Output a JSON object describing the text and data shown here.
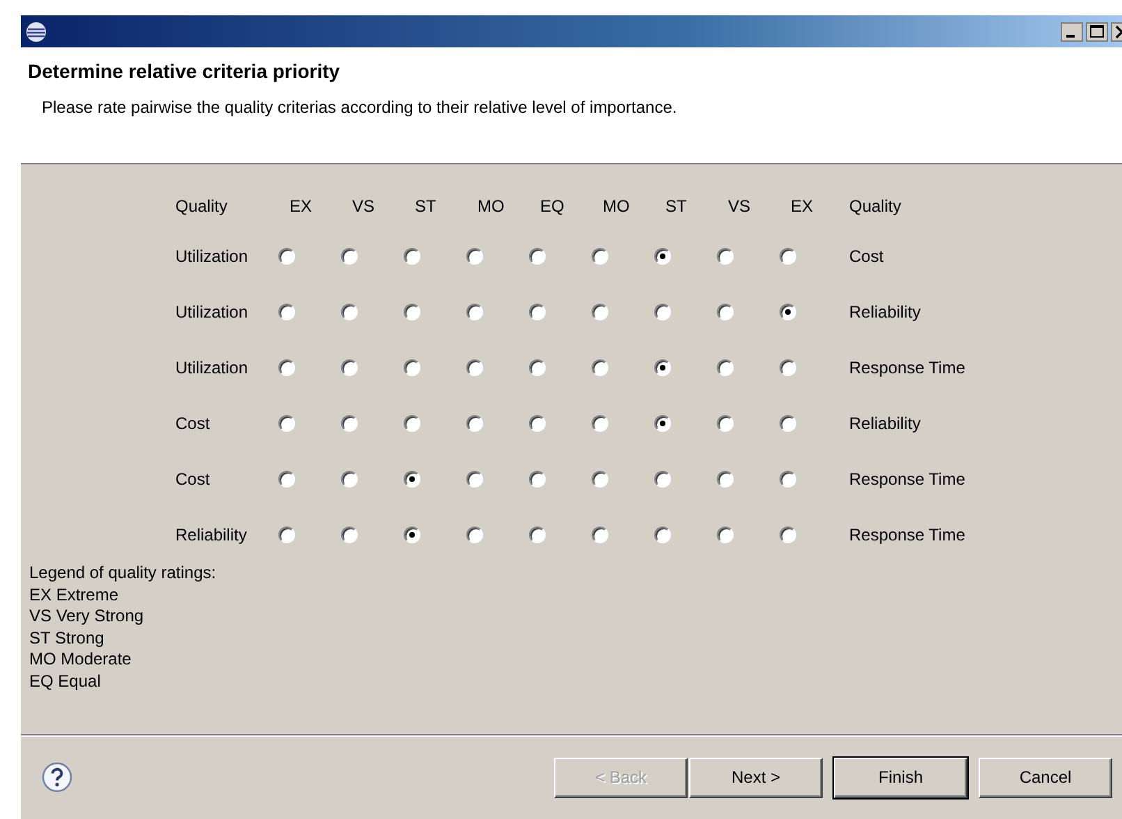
{
  "header": {
    "title": "Determine relative criteria priority",
    "description": "Please rate pairwise the quality criterias according to their relative level of importance."
  },
  "grid": {
    "left_heading": "Quality",
    "right_heading": "Quality",
    "scale": [
      "EX",
      "VS",
      "ST",
      "MO",
      "EQ",
      "MO",
      "ST",
      "VS",
      "EX"
    ],
    "rows": [
      {
        "left": "Utilization",
        "right": "Cost",
        "ratings": [
          {
            "selected": false
          },
          {
            "selected": false
          },
          {
            "selected": false
          },
          {
            "selected": false
          },
          {
            "selected": false
          },
          {
            "selected": false
          },
          {
            "selected": true
          },
          {
            "selected": false
          },
          {
            "selected": false
          }
        ]
      },
      {
        "left": "Utilization",
        "right": "Reliability",
        "ratings": [
          {
            "selected": false
          },
          {
            "selected": false
          },
          {
            "selected": false
          },
          {
            "selected": false
          },
          {
            "selected": false
          },
          {
            "selected": false
          },
          {
            "selected": false
          },
          {
            "selected": false
          },
          {
            "selected": true
          }
        ]
      },
      {
        "left": "Utilization",
        "right": "Response Time",
        "ratings": [
          {
            "selected": false
          },
          {
            "selected": false
          },
          {
            "selected": false
          },
          {
            "selected": false
          },
          {
            "selected": false
          },
          {
            "selected": false
          },
          {
            "selected": true
          },
          {
            "selected": false
          },
          {
            "selected": false
          }
        ]
      },
      {
        "left": "Cost",
        "right": "Reliability",
        "ratings": [
          {
            "selected": false
          },
          {
            "selected": false
          },
          {
            "selected": false
          },
          {
            "selected": false
          },
          {
            "selected": false
          },
          {
            "selected": false
          },
          {
            "selected": true
          },
          {
            "selected": false
          },
          {
            "selected": false
          }
        ]
      },
      {
        "left": "Cost",
        "right": "Response Time",
        "ratings": [
          {
            "selected": false
          },
          {
            "selected": false
          },
          {
            "selected": true
          },
          {
            "selected": false
          },
          {
            "selected": false
          },
          {
            "selected": false
          },
          {
            "selected": false
          },
          {
            "selected": false
          },
          {
            "selected": false
          }
        ]
      },
      {
        "left": "Reliability",
        "right": "Response Time",
        "ratings": [
          {
            "selected": false
          },
          {
            "selected": false
          },
          {
            "selected": true
          },
          {
            "selected": false
          },
          {
            "selected": false
          },
          {
            "selected": false
          },
          {
            "selected": false
          },
          {
            "selected": false
          },
          {
            "selected": false
          }
        ]
      }
    ]
  },
  "legend": [
    "Legend of quality ratings:",
    "EX Extreme",
    "VS Very Strong",
    "ST Strong",
    "MO Moderate",
    "EQ Equal"
  ],
  "buttons": [
    {
      "label": "< Back",
      "disabled": true,
      "default": false
    },
    {
      "label": "Next >",
      "disabled": false,
      "default": false
    },
    {
      "label": "Finish",
      "disabled": false,
      "default": true
    },
    {
      "label": "Cancel",
      "disabled": false,
      "default": false
    }
  ]
}
